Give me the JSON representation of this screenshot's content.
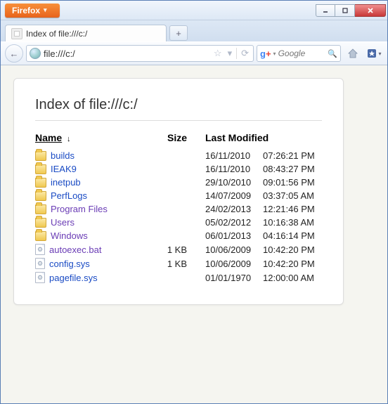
{
  "app": {
    "name": "Firefox"
  },
  "window_controls": {
    "minimize": "–",
    "maximize": "□",
    "close": "×"
  },
  "tab": {
    "title": "Index of file:///c:/",
    "new_tab": "+"
  },
  "nav": {
    "back": "←",
    "url": "file:///c:/",
    "star": "☆",
    "dropdown": "▾",
    "reload": "⟳",
    "search_engine": "Google",
    "search_placeholder": "Google",
    "search_go": "🔍"
  },
  "page": {
    "title": "Index of file:///c:/",
    "columns": {
      "name": "Name",
      "size": "Size",
      "modified": "Last Modified"
    },
    "sort_indicator": "↓",
    "rows": [
      {
        "type": "folder",
        "name": "builds",
        "size": "",
        "date": "16/11/2010",
        "time": "07:26:21 PM",
        "visited": false
      },
      {
        "type": "folder",
        "name": "IEAK9",
        "size": "",
        "date": "16/11/2010",
        "time": "08:43:27 PM",
        "visited": false
      },
      {
        "type": "folder",
        "name": "inetpub",
        "size": "",
        "date": "29/10/2010",
        "time": "09:01:56 PM",
        "visited": false
      },
      {
        "type": "folder",
        "name": "PerfLogs",
        "size": "",
        "date": "14/07/2009",
        "time": "03:37:05 AM",
        "visited": false
      },
      {
        "type": "folder",
        "name": "Program Files",
        "size": "",
        "date": "24/02/2013",
        "time": "12:21:46 PM",
        "visited": true
      },
      {
        "type": "folder",
        "name": "Users",
        "size": "",
        "date": "05/02/2012",
        "time": "10:16:38 AM",
        "visited": true
      },
      {
        "type": "folder",
        "name": "Windows",
        "size": "",
        "date": "06/01/2013",
        "time": "04:16:14 PM",
        "visited": true
      },
      {
        "type": "file",
        "name": "autoexec.bat",
        "size": "1 KB",
        "date": "10/06/2009",
        "time": "10:42:20 PM",
        "visited": true
      },
      {
        "type": "file",
        "name": "config.sys",
        "size": "1 KB",
        "date": "10/06/2009",
        "time": "10:42:20 PM",
        "visited": false
      },
      {
        "type": "file",
        "name": "pagefile.sys",
        "size": "",
        "date": "01/01/1970",
        "time": "12:00:00 AM",
        "visited": false
      }
    ]
  }
}
